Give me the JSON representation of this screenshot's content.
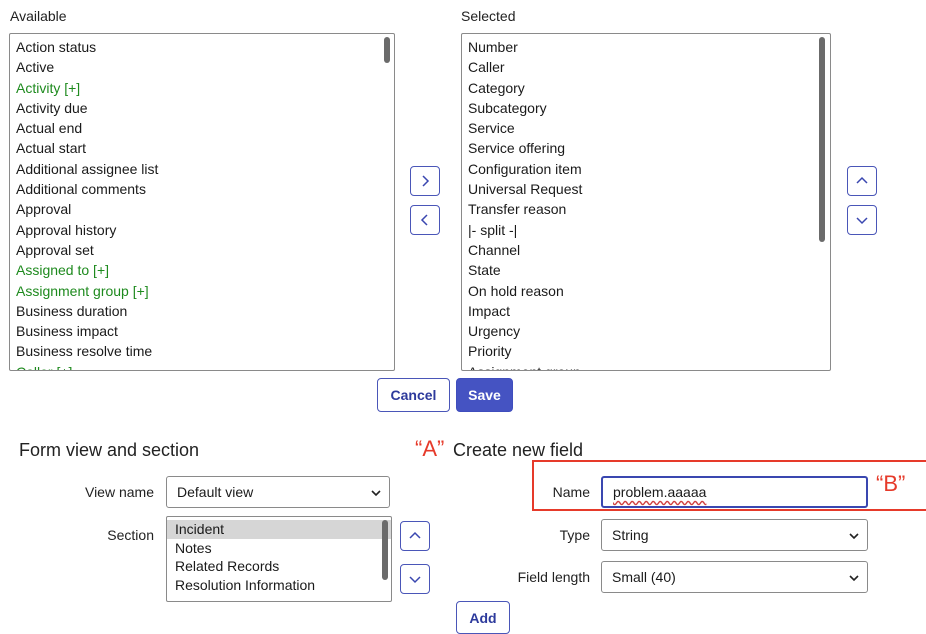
{
  "available": {
    "title": "Available",
    "items": [
      {
        "label": "Action status",
        "ref": false
      },
      {
        "label": "Active",
        "ref": false
      },
      {
        "label": "Activity [+]",
        "ref": true
      },
      {
        "label": "Activity due",
        "ref": false
      },
      {
        "label": "Actual end",
        "ref": false
      },
      {
        "label": "Actual start",
        "ref": false
      },
      {
        "label": "Additional assignee list",
        "ref": false
      },
      {
        "label": "Additional comments",
        "ref": false
      },
      {
        "label": "Approval",
        "ref": false
      },
      {
        "label": "Approval history",
        "ref": false
      },
      {
        "label": "Approval set",
        "ref": false
      },
      {
        "label": "Assigned to [+]",
        "ref": true
      },
      {
        "label": "Assignment group [+]",
        "ref": true
      },
      {
        "label": "Business duration",
        "ref": false
      },
      {
        "label": "Business impact",
        "ref": false
      },
      {
        "label": "Business resolve time",
        "ref": false
      },
      {
        "label": "Caller [+]",
        "ref": true
      }
    ]
  },
  "selected": {
    "title": "Selected",
    "items": [
      {
        "label": "Number"
      },
      {
        "label": "Caller"
      },
      {
        "label": "Category"
      },
      {
        "label": "Subcategory"
      },
      {
        "label": "Service"
      },
      {
        "label": "Service offering"
      },
      {
        "label": "Configuration item"
      },
      {
        "label": "Universal Request"
      },
      {
        "label": "Transfer reason"
      },
      {
        "label": "|- split -|"
      },
      {
        "label": "Channel"
      },
      {
        "label": "State"
      },
      {
        "label": "On hold reason"
      },
      {
        "label": "Impact"
      },
      {
        "label": "Urgency"
      },
      {
        "label": "Priority"
      },
      {
        "label": "Assignment group"
      }
    ]
  },
  "actions": {
    "cancel_label": "Cancel",
    "save_label": "Save",
    "add_label": "Add"
  },
  "form_view": {
    "title": "Form view and section",
    "view_name_label": "View name",
    "view_name_value": "Default view",
    "section_label": "Section",
    "sections": [
      {
        "label": "Incident",
        "selected": true
      },
      {
        "label": "Notes",
        "selected": false
      },
      {
        "label": "Related Records",
        "selected": false
      },
      {
        "label": "Resolution Information",
        "selected": false
      }
    ]
  },
  "new_field": {
    "title": "Create new field",
    "name_label": "Name",
    "name_value": "problem.aaaaa",
    "type_label": "Type",
    "type_value": "String",
    "length_label": "Field length",
    "length_value": "Small (40)"
  },
  "annotations": {
    "a": "“A”",
    "b": "“B”",
    "color": "#e63a2a"
  },
  "icons": {
    "move_right": "chevron-right-icon",
    "move_left": "chevron-left-icon",
    "move_up": "chevron-up-icon",
    "move_down": "chevron-down-icon"
  }
}
